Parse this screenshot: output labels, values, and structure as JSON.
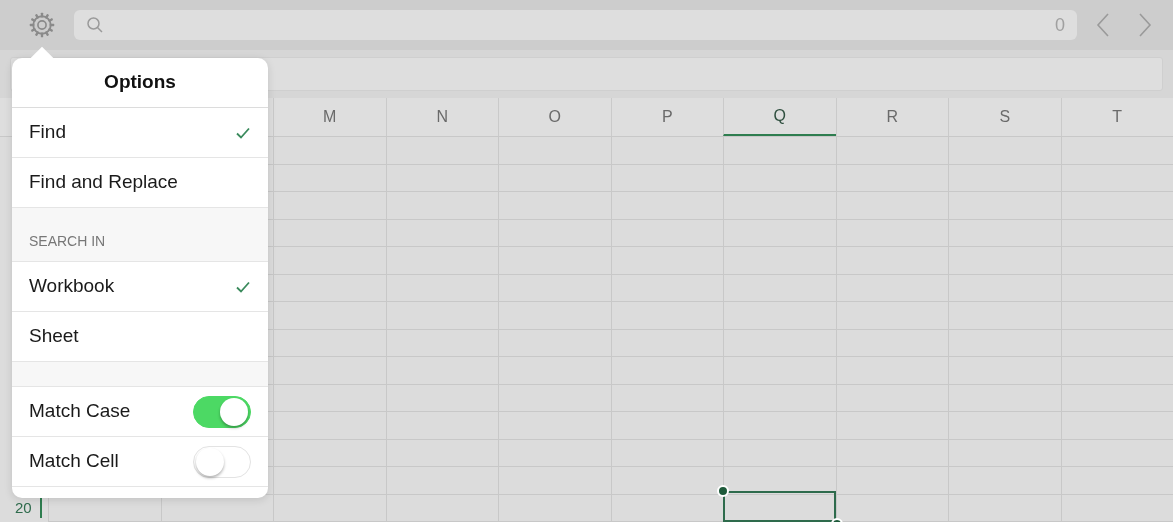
{
  "toolbar": {
    "search": {
      "count": "0"
    }
  },
  "columns": [
    {
      "label": "M",
      "selected": false
    },
    {
      "label": "N",
      "selected": false
    },
    {
      "label": "O",
      "selected": false
    },
    {
      "label": "P",
      "selected": false
    },
    {
      "label": "Q",
      "selected": true
    },
    {
      "label": "R",
      "selected": false
    },
    {
      "label": "S",
      "selected": false
    },
    {
      "label": "T",
      "selected": false
    }
  ],
  "active_row": {
    "label": "20",
    "selected": true
  },
  "options_popover": {
    "title": "Options",
    "sections": [
      {
        "items": [
          {
            "kind": "check",
            "label": "Find",
            "checked": true
          },
          {
            "kind": "check",
            "label": "Find and Replace",
            "checked": false
          }
        ]
      },
      {
        "header": "SEARCH IN",
        "items": [
          {
            "kind": "check",
            "label": "Workbook",
            "checked": true
          },
          {
            "kind": "check",
            "label": "Sheet",
            "checked": false
          }
        ]
      },
      {
        "items": [
          {
            "kind": "toggle",
            "label": "Match Case",
            "on": true
          },
          {
            "kind": "toggle",
            "label": "Match Cell",
            "on": false
          }
        ]
      }
    ]
  }
}
